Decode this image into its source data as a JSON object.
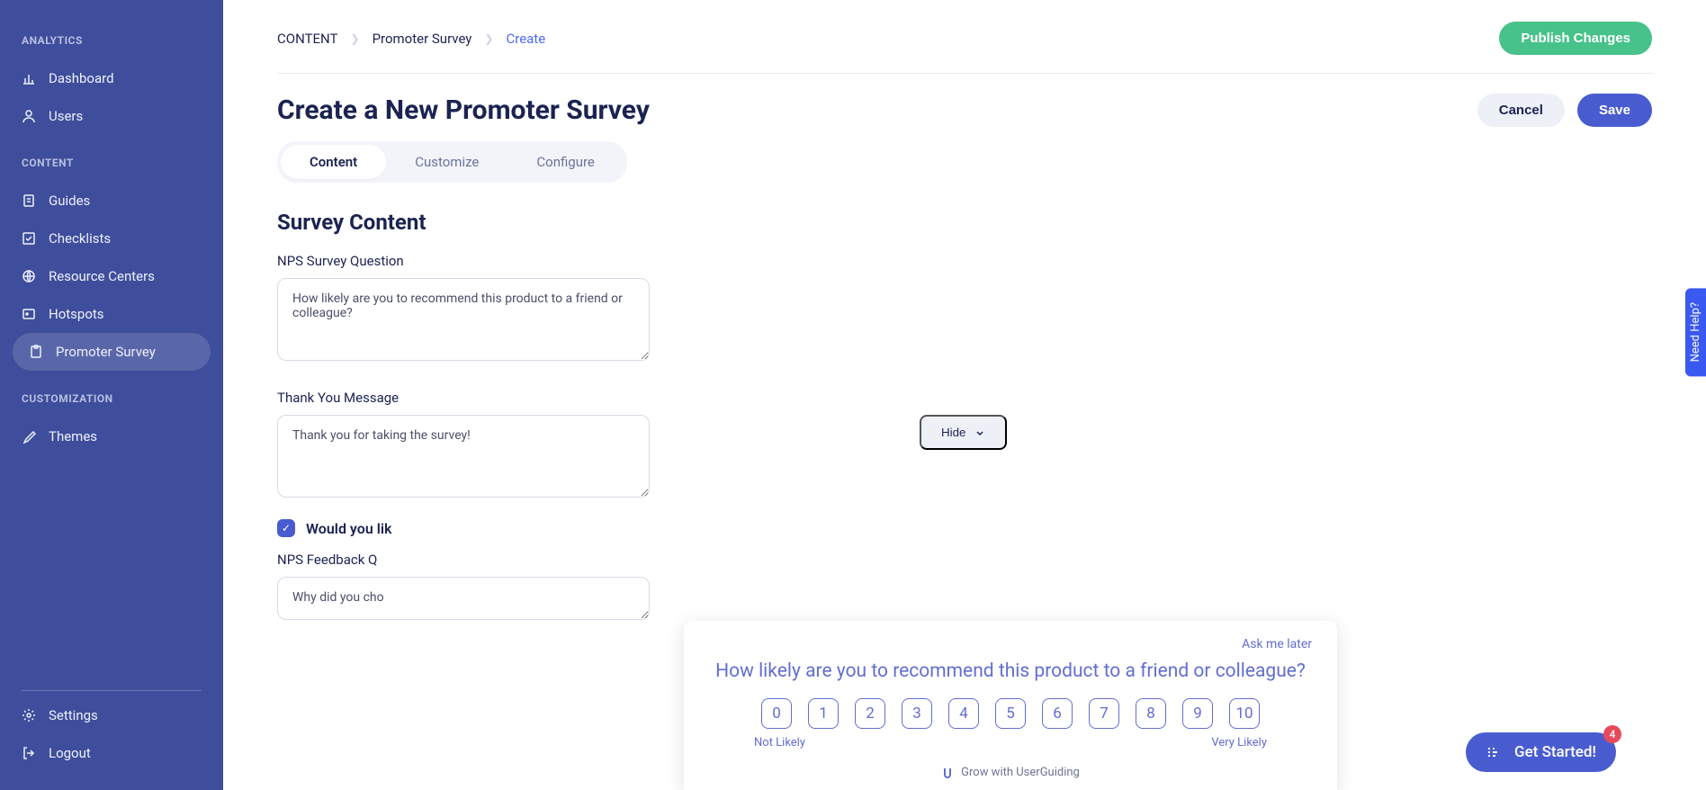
{
  "sidebar": {
    "sections": {
      "analytics": {
        "label": "ANALYTICS",
        "items": [
          {
            "label": "Dashboard"
          },
          {
            "label": "Users"
          }
        ]
      },
      "content": {
        "label": "CONTENT",
        "items": [
          {
            "label": "Guides"
          },
          {
            "label": "Checklists"
          },
          {
            "label": "Resource Centers"
          },
          {
            "label": "Hotspots"
          },
          {
            "label": "Promoter Survey",
            "active": true
          }
        ]
      },
      "customization": {
        "label": "CUSTOMIZATION",
        "items": [
          {
            "label": "Themes"
          }
        ]
      },
      "footer": {
        "items": [
          {
            "label": "Settings"
          },
          {
            "label": "Logout"
          }
        ]
      }
    }
  },
  "breadcrumb": {
    "a": "CONTENT",
    "b": "Promoter Survey",
    "c": "Create"
  },
  "buttons": {
    "publish": "Publish Changes",
    "cancel": "Cancel",
    "save": "Save",
    "hide": "Hide"
  },
  "page_title": "Create a New Promoter Survey",
  "tabs": [
    "Content",
    "Customize",
    "Configure"
  ],
  "section_title": "Survey Content",
  "fields": {
    "nps_question_label": "NPS Survey Question",
    "nps_question_value": "How likely are you to recommend this product to a friend or colleague?",
    "thank_you_label": "Thank You Message",
    "thank_you_value": "Thank you for taking the survey!",
    "feedback_checkbox": "Would you lik",
    "feedback_label": "NPS Feedback Q",
    "feedback_value": "Why did you cho"
  },
  "nps_preview": {
    "ask_later": "Ask me later",
    "question": "How likely are you to recommend this product to a friend or colleague?",
    "scores": [
      "0",
      "1",
      "2",
      "3",
      "4",
      "5",
      "6",
      "7",
      "8",
      "9",
      "10"
    ],
    "low_label": "Not Likely",
    "high_label": "Very Likely",
    "brand": "Grow with UserGuiding"
  },
  "get_started": {
    "label": "Get Started!",
    "badge": "4"
  },
  "need_help": "Need Help?"
}
